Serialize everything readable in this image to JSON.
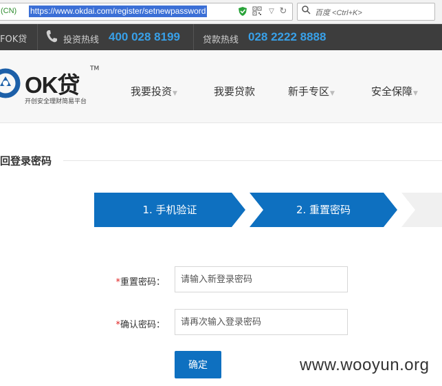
{
  "browser": {
    "security_label": "(CN)",
    "url": "https://www.okdai.com/register/setnewpassword",
    "search_placeholder": "百度 <Ctrl+K>"
  },
  "topbar": {
    "brand": "FOK贷",
    "invest_hotline_label": "投资热线",
    "invest_hotline_number": "400 028 8199",
    "loan_hotline_label": "贷款热线",
    "loan_hotline_number": "028 2222 8888"
  },
  "logo": {
    "name": "OK贷",
    "tm": "TM",
    "slogan": "开创安全理财简易平台"
  },
  "nav": {
    "items": [
      {
        "label": "我要投资",
        "has_dropdown": true
      },
      {
        "label": "我要贷款",
        "has_dropdown": false
      },
      {
        "label": "新手专区",
        "has_dropdown": true
      },
      {
        "label": "安全保障",
        "has_dropdown": true
      }
    ]
  },
  "page": {
    "title": "找回登录密码"
  },
  "steps": [
    {
      "label": "1. 手机验证"
    },
    {
      "label": "2. 重置密码"
    }
  ],
  "form": {
    "required_mark": "*",
    "new_password_label": "重置密码：",
    "new_password_placeholder": "请输入新登录密码",
    "confirm_password_label": "确认密码：",
    "confirm_password_placeholder": "请再次输入登录密码",
    "submit_label": "确定"
  },
  "watermark": "www.wooyun.org",
  "colors": {
    "primary": "#0e70c0",
    "hotline_number": "#38a0e8",
    "topbar_bg": "#3d3d3d",
    "required": "#e02020"
  }
}
